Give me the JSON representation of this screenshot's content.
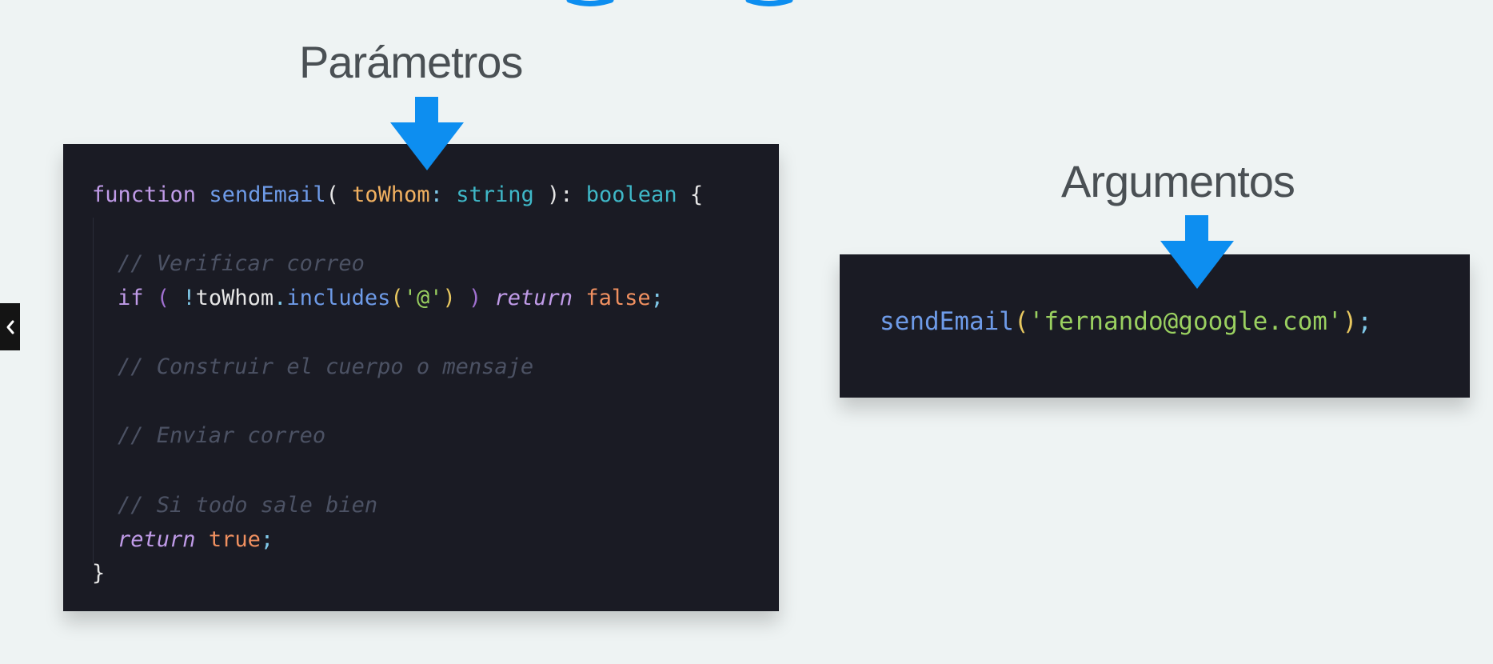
{
  "headings": {
    "parametros": "Parámetros",
    "argumentos": "Argumentos"
  },
  "colors": {
    "background": "#eef3f3",
    "arrow": "#0d8ef0",
    "panel": "#1a1b24",
    "heading_text": "#4a5054"
  },
  "icons": {
    "arrow": "arrow-down-icon",
    "nav": "chevron-left-icon"
  },
  "function_code": {
    "line1": {
      "kw": "function",
      "name": "sendEmail",
      "open": "( ",
      "param": "toWhom",
      "colon": ": ",
      "type": "string",
      "close": " ): ",
      "return_type": "boolean",
      "brace": " {"
    },
    "comment1": "// Verificar correo",
    "if_line": {
      "kw": "if",
      "paren_open": "( ",
      "not": "!",
      "obj": "toWhom",
      "dot": ".",
      "method": "includes",
      "call_open": "(",
      "str": "'@'",
      "call_close": ")",
      "paren_close": " )",
      "ret": "return",
      "val": "false",
      "semi": ";"
    },
    "comment2": "// Construir el cuerpo o mensaje",
    "comment3": "// Enviar correo",
    "comment4": "// Si todo sale bien",
    "return_line": {
      "kw": "return",
      "val": "true",
      "semi": ";"
    },
    "closing_brace": "}"
  },
  "argument_code": {
    "name": "sendEmail",
    "open": "(",
    "str": "'fernando@google.com'",
    "close": ")",
    "semi": ";"
  },
  "nav": {
    "prev_glyph": "‹"
  }
}
